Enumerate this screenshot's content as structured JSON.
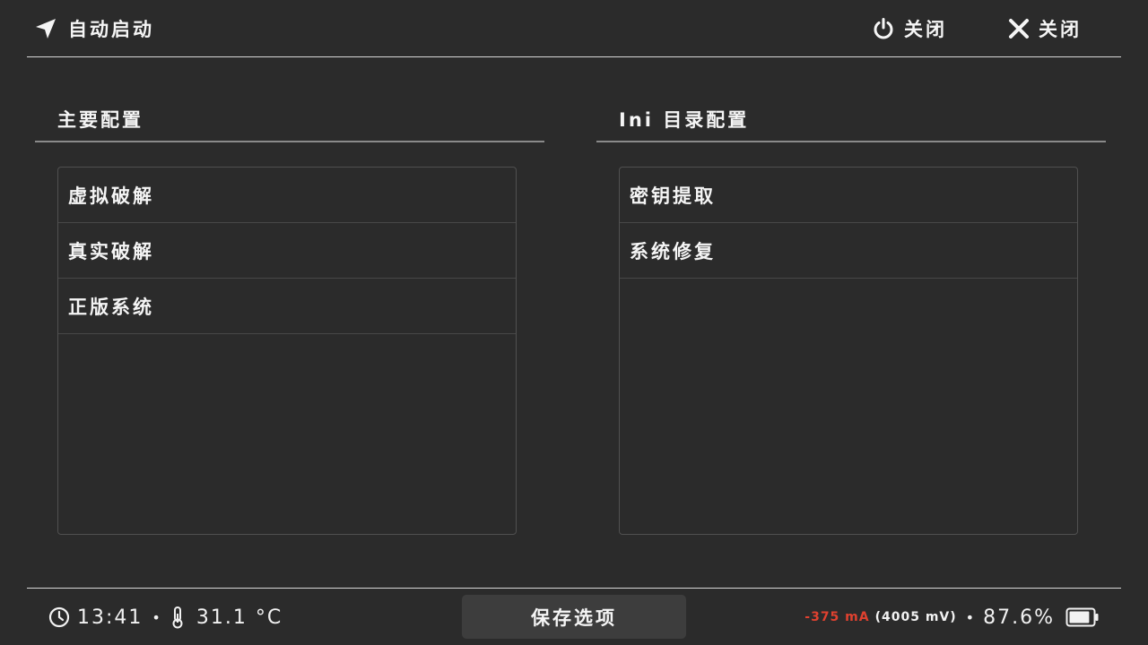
{
  "header": {
    "auto_start_label": "自动启动",
    "power_off_label": "关闭",
    "close_label": "关闭"
  },
  "sections": {
    "left": {
      "title": "主要配置",
      "items": [
        "虚拟破解",
        "真实破解",
        "正版系统"
      ]
    },
    "right": {
      "title": "Ini 目录配置",
      "items": [
        "密钥提取",
        "系统修复"
      ]
    }
  },
  "footer": {
    "time": "13:41",
    "temperature": "31.1 °C",
    "save_label": "保存选项",
    "current": "-375 mA",
    "voltage": "(4005 mV)",
    "battery": "87.6%"
  },
  "colors": {
    "background": "#2b2b2b",
    "current_warning": "#e0412f",
    "button_bg": "#3d3d3d"
  },
  "icons": {
    "auto_start": "navigation-arrow-icon",
    "power_off": "power-icon",
    "close": "close-icon",
    "time": "clock-icon",
    "temperature": "thermometer-icon",
    "battery": "battery-icon"
  },
  "battery_level": 0.876
}
